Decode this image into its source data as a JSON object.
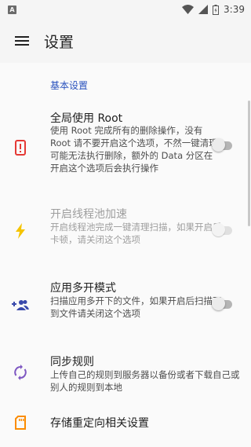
{
  "status_bar": {
    "app_icon_letter": "A",
    "time": "3:39",
    "icons": [
      "wifi-icon",
      "signal-icon",
      "battery-icon"
    ]
  },
  "toolbar": {
    "title": "设置",
    "menu_icon": "menu-icon"
  },
  "section": {
    "header": "基本设置"
  },
  "items": [
    {
      "title": "全局使用 Root",
      "summary": "使用 Root 完成所有的删除操作，没有 Root 请不要开启这个选项，不然一键清理可能无法执行删除，额外的 Data 分区在 开启这个选项后会执行操作",
      "icon": "root-icon",
      "toggle": "off",
      "enabled": true
    },
    {
      "title": "开启线程池加速",
      "summary": "开启线程池完成一键清理扫描，如果开启后卡顿，请关闭这个选项",
      "icon": "lightning-icon",
      "toggle": "off",
      "enabled": false
    },
    {
      "title": "应用多开模式",
      "summary": "扫描应用多开下的文件，如果开启后扫描不到文件请关闭这个选项",
      "icon": "multi-user-icon",
      "toggle": "off",
      "enabled": true
    },
    {
      "title": "同步规则",
      "summary": "上传自己的规则到服务器以备份或者下载自己或别人的规则到本地",
      "icon": "sync-icon",
      "enabled": true
    },
    {
      "title": "存储重定向相关设置",
      "icon": "sd-card-icon",
      "enabled": true
    }
  ],
  "colors": {
    "accent": "#2a52be",
    "root_icon": "#e53935",
    "lightning_icon": "#f5c400",
    "multi_user_icon": "#3949ab",
    "sync_icon": "#7e57c2",
    "sd_card_icon": "#fb8c00"
  }
}
